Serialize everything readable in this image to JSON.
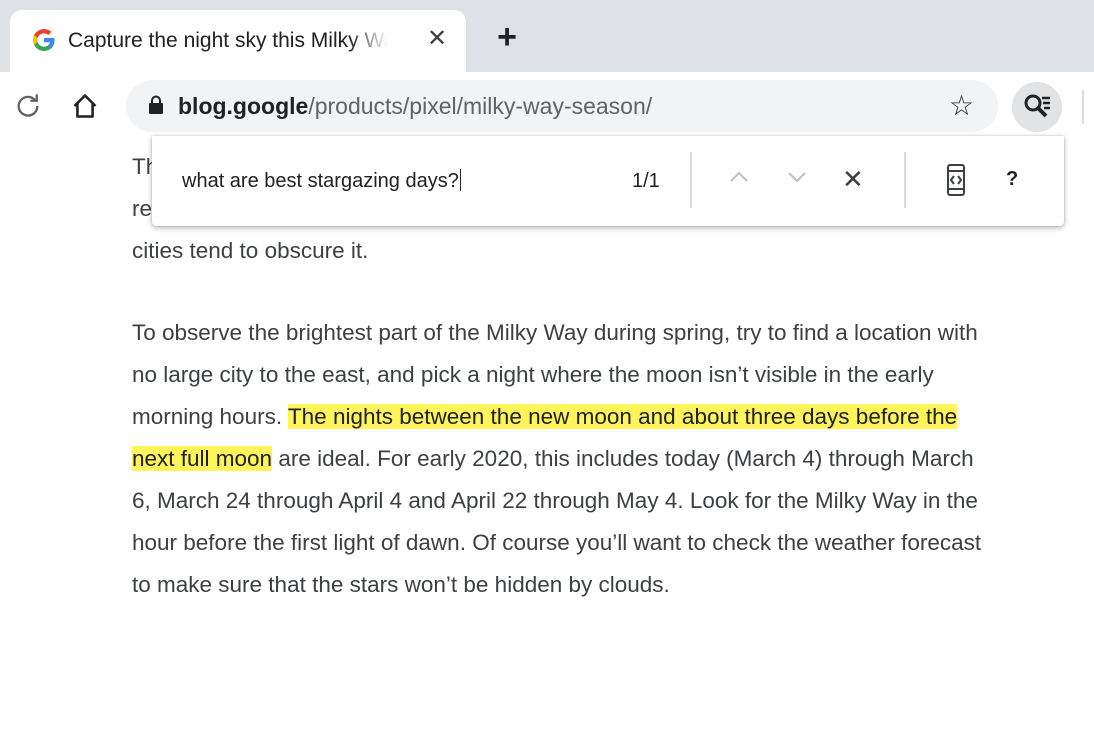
{
  "tab": {
    "title": "Capture the night sky this Milky Way season",
    "close_glyph": "✕",
    "new_tab_glyph": "+",
    "favicon": "google-g-icon"
  },
  "toolbar": {
    "url_host": "blog.google",
    "url_path": "/products/pixel/milky-way-season/",
    "star_glyph": "☆"
  },
  "find_bar": {
    "query": "what are best stargazing days?",
    "match_count": "1/1",
    "close_glyph": "✕",
    "help_glyph": "?"
  },
  "article": {
    "p1_partial_line1": "Th",
    "p1_partial_line2": "re",
    "p1_line3": "cities tend to obscure it.",
    "p2_before": "To observe the brightest part of the Milky Way during spring, try to find a location with no large city to the east, and pick a night where the moon isn’t visible in the early morning hours. ",
    "p2_highlight": "The nights between the new moon and about three days before the next full moon",
    "p2_after": " are ideal. For early 2020, this includes today (March 4) through March 6, March 24 through April 4 and April 22 through May 4. Look for the Milky Way in the hour before the first light of dawn. Of course you’ll want to check the weather forecast to make sure that the stars won’t be hidden by clouds."
  },
  "colors": {
    "highlight": "#fff459",
    "tabstrip": "#dee1e6",
    "omnibox": "#f1f3f4"
  }
}
